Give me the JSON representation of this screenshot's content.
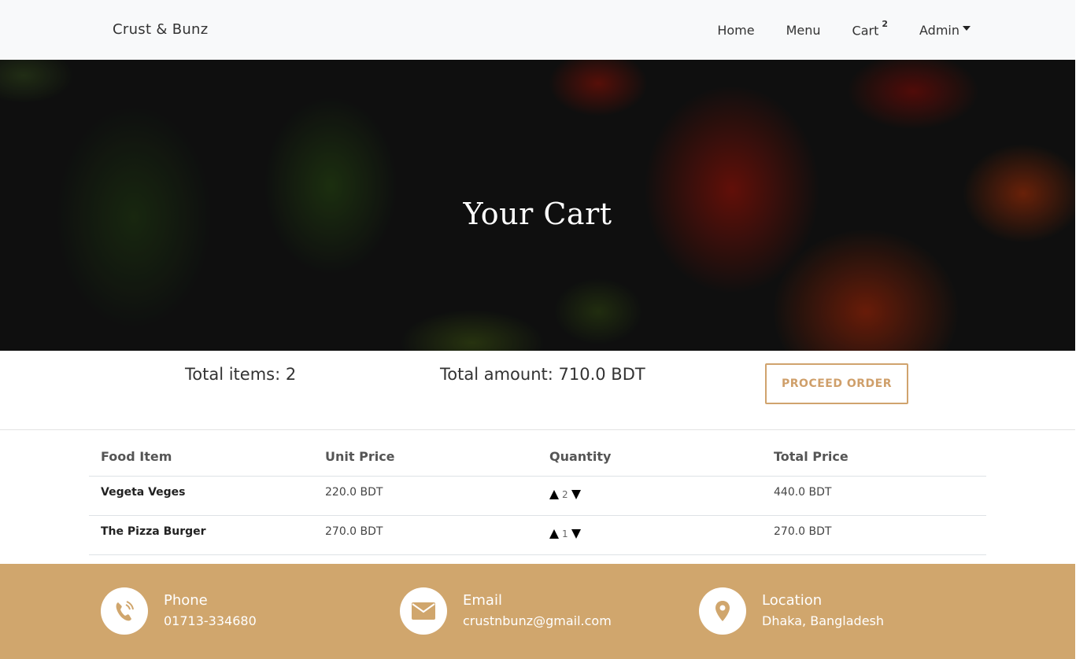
{
  "navbar": {
    "brand": "Crust & Bunz",
    "links": [
      {
        "label": "Home"
      },
      {
        "label": "Menu"
      },
      {
        "label": "Cart",
        "badge": "2"
      },
      {
        "label": "Admin"
      }
    ]
  },
  "hero": {
    "title": "Your Cart"
  },
  "summary": {
    "total_items": "Total items: 2",
    "total_amount": "Total amount: 710.0 BDT",
    "proceed_label": "PROCEED ORDER"
  },
  "table": {
    "headers": [
      "Food Item",
      "Unit Price",
      "Quantity",
      "Total Price"
    ],
    "rows": [
      {
        "name": "Vegeta Veges",
        "unit_price": "220.0 BDT",
        "quantity": "2",
        "total": "440.0 BDT"
      },
      {
        "name": "The Pizza Burger",
        "unit_price": "270.0 BDT",
        "quantity": "1",
        "total": "270.0 BDT"
      }
    ]
  },
  "footer": {
    "phone": {
      "label": "Phone",
      "value": "01713-334680",
      "icon": "phone-icon"
    },
    "email": {
      "label": "Email",
      "value": "crustnbunz@gmail.com",
      "icon": "envelope-icon"
    },
    "location": {
      "label": "Location",
      "value": "Dhaka, Bangladesh",
      "icon": "map-pin-icon"
    }
  },
  "colors": {
    "accent": "#d0a66d",
    "navbar_bg": "#f8f9fa"
  }
}
